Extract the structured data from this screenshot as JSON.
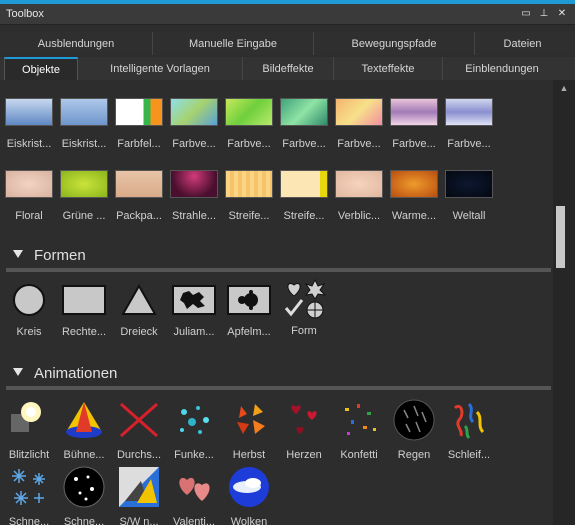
{
  "window": {
    "title": "Toolbox",
    "accent": "#1e9bd7"
  },
  "tabs_row1": [
    "Ausblendungen",
    "Manuelle Eingabe",
    "Bewegungspfade",
    "Dateien"
  ],
  "tabs_row2": [
    "Objekte",
    "Intelligente Vorlagen",
    "Bildeffekte",
    "Texteffekte",
    "Einblendungen"
  ],
  "active_tab": "Objekte",
  "backgrounds_row1": [
    {
      "label": "Eiskrist...",
      "icon": "ice-crystal-bg"
    },
    {
      "label": "Eiskrist...",
      "icon": "ice-crystal-bg"
    },
    {
      "label": "Farbfel...",
      "icon": "color-field-bg"
    },
    {
      "label": "Farbve...",
      "icon": "gradient-bg"
    },
    {
      "label": "Farbve...",
      "icon": "gradient-bg"
    },
    {
      "label": "Farbve...",
      "icon": "gradient-bg"
    },
    {
      "label": "Farbve...",
      "icon": "gradient-bg"
    },
    {
      "label": "Farbve...",
      "icon": "gradient-bg"
    },
    {
      "label": "Farbve...",
      "icon": "gradient-bg"
    }
  ],
  "backgrounds_row2": [
    {
      "label": "Floral",
      "icon": "floral-bg"
    },
    {
      "label": "Grüne ...",
      "icon": "green-bg"
    },
    {
      "label": "Packpa...",
      "icon": "packpaper-bg"
    },
    {
      "label": "Strahle...",
      "icon": "rays-bg"
    },
    {
      "label": "Streife...",
      "icon": "stripes-bg"
    },
    {
      "label": "Streife...",
      "icon": "stripes-bg"
    },
    {
      "label": "Verblic...",
      "icon": "faded-bg"
    },
    {
      "label": "Warme...",
      "icon": "warm-bg"
    },
    {
      "label": "Weltall",
      "icon": "space-bg"
    }
  ],
  "sections": {
    "forms": "Formen",
    "animations": "Animationen"
  },
  "forms": [
    {
      "label": "Kreis",
      "icon": "circle-icon"
    },
    {
      "label": "Rechte...",
      "icon": "rectangle-icon"
    },
    {
      "label": "Dreieck",
      "icon": "triangle-icon"
    },
    {
      "label": "Juliam...",
      "icon": "julia-set-icon"
    },
    {
      "label": "Apfelm...",
      "icon": "mandelbrot-icon"
    },
    {
      "label": "Form",
      "icon": "custom-shape-icon"
    }
  ],
  "animations": [
    {
      "label": "Blitzlicht",
      "icon": "flashlight-icon"
    },
    {
      "label": "Bühne...",
      "icon": "stage-icon"
    },
    {
      "label": "Durchs...",
      "icon": "cross-icon"
    },
    {
      "label": "Funke...",
      "icon": "sparks-icon"
    },
    {
      "label": "Herbst",
      "icon": "autumn-leaves-icon"
    },
    {
      "label": "Herzen",
      "icon": "hearts-icon"
    },
    {
      "label": "Konfetti",
      "icon": "confetti-icon"
    },
    {
      "label": "Regen",
      "icon": "rain-icon"
    },
    {
      "label": "Schleif...",
      "icon": "ribbons-icon"
    },
    {
      "label": "Schne...",
      "icon": "snowflakes-icon"
    },
    {
      "label": "Schne...",
      "icon": "snow-globe-icon"
    },
    {
      "label": "S/W n...",
      "icon": "bw-icon"
    },
    {
      "label": "Valenti...",
      "icon": "valentine-icon"
    },
    {
      "label": "Wolken",
      "icon": "clouds-icon"
    }
  ]
}
